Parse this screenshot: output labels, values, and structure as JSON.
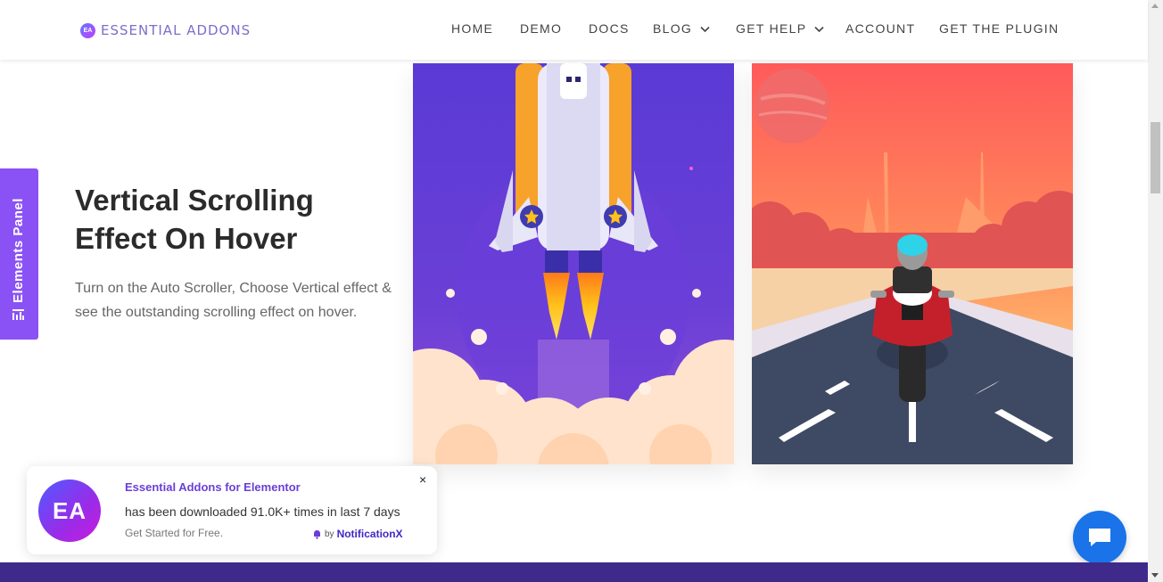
{
  "header": {
    "logo_text": "ESSENTIAL ADDONS",
    "logo_mark": "EA",
    "nav": [
      {
        "label": "HOME",
        "has_dropdown": false
      },
      {
        "label": "DEMO",
        "has_dropdown": false
      },
      {
        "label": "DOCS",
        "has_dropdown": false
      },
      {
        "label": "BLOG",
        "has_dropdown": true
      },
      {
        "label": "GET HELP",
        "has_dropdown": true
      },
      {
        "label": "ACCOUNT",
        "has_dropdown": false
      },
      {
        "label": "GET THE PLUGIN",
        "has_dropdown": false
      }
    ]
  },
  "side_tab": {
    "label": "Elements Panel",
    "icon": "bar-chart-icon"
  },
  "main": {
    "title": "Vertical Scrolling Effect On Hover",
    "description": "Turn on the Auto Scroller, Choose Vertical effect & see the outstanding scrolling effect on hover.",
    "cards": [
      {
        "name": "rocket-illustration"
      },
      {
        "name": "motorcycle-illustration"
      }
    ]
  },
  "notification": {
    "logo_mark": "EA",
    "title": "Essential Addons for Elementor",
    "body": "has been downloaded 91.0K+ times in last 7 days",
    "cta": "Get Started for Free.",
    "by_prefix": "by",
    "brand": "NotificationX",
    "close": "×"
  },
  "chat": {
    "icon": "chat-icon"
  },
  "colors": {
    "accent_purple": "#8a52f5",
    "rocket_bg": "#5b3bd6",
    "chat_blue": "#1a73e8",
    "band": "#3f2a8c"
  }
}
